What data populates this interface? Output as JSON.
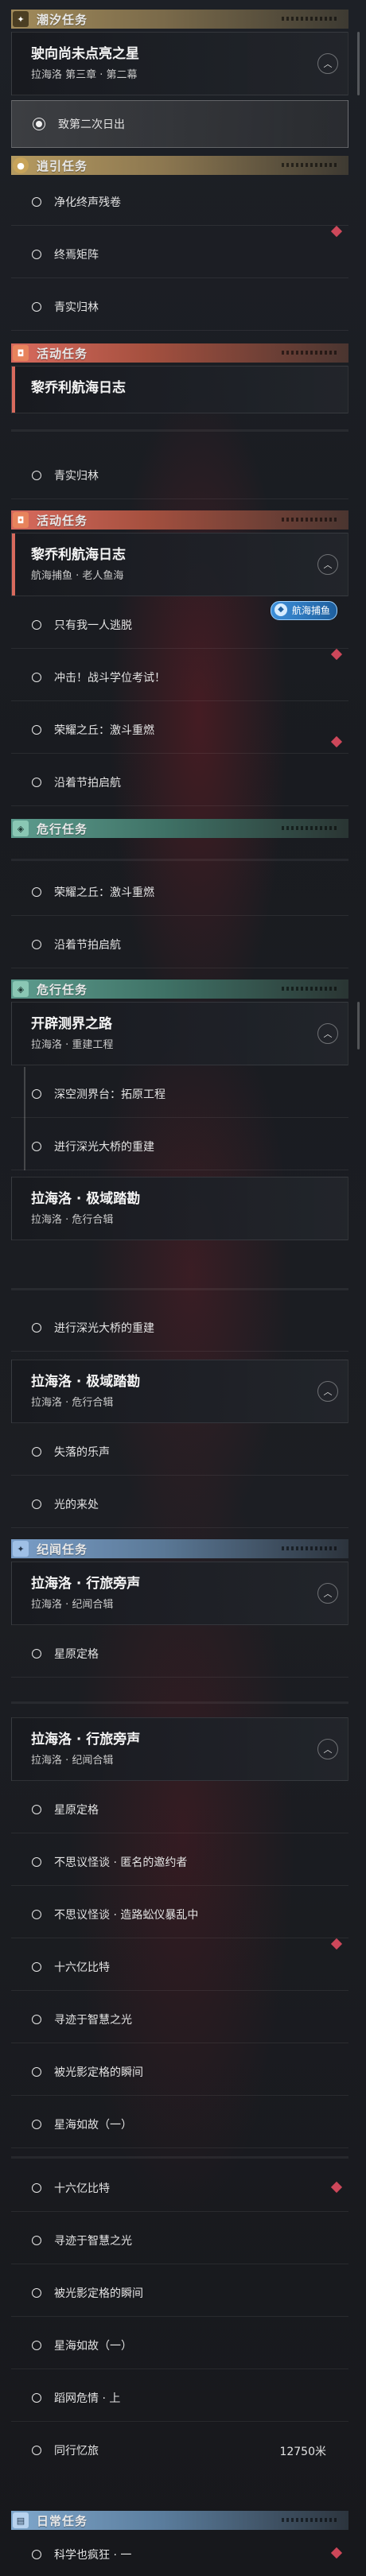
{
  "categories": {
    "tide": "潮汐任务",
    "guide": "逍引任务",
    "event": "活动任务",
    "danger": "危行任务",
    "chronicle": "纪闻任务",
    "daily": "日常任务"
  },
  "quests": {
    "q1": {
      "title": "驶向尚未点亮之星",
      "sub": "拉海洛 第三章 · 第二幕"
    },
    "q2": {
      "title": "黎乔利航海日志"
    },
    "q3": {
      "title": "黎乔利航海日志",
      "sub": "航海捕鱼 · 老人鱼海"
    },
    "q4": {
      "title": "开辟测界之路",
      "sub": "拉海洛 · 重建工程"
    },
    "q5": {
      "title": "拉海洛 · 极域踏勘",
      "sub": "拉海洛 · 危行合辑"
    },
    "q6": {
      "title": "拉海洛 · 极域踏勘",
      "sub": "拉海洛 · 危行合辑"
    },
    "q7": {
      "title": "拉海洛 · 行旅旁声",
      "sub": "拉海洛 · 纪闻合辑"
    },
    "q8": {
      "title": "拉海洛 · 行旅旁声",
      "sub": "拉海洛 · 纪闻合辑"
    }
  },
  "steps": {
    "s1": "致第二次日出",
    "s2": "净化终声残卷",
    "s3": "终焉矩阵",
    "s4": "青实归林",
    "s5": "青实归林",
    "s6": "只有我一人逃脱",
    "s7": "冲击！战斗学位考试！",
    "s8": "荣耀之丘：激斗重燃",
    "s9": "沿着节拍启航",
    "s10": "荣耀之丘：激斗重燃",
    "s11": "沿着节拍启航",
    "s12": "深空测界台：拓原工程",
    "s13": "进行深光大桥的重建",
    "s14": "进行深光大桥的重建",
    "s15": "失落的乐声",
    "s16": "光的来处",
    "s17": "星原定格",
    "s18": "星原定格",
    "s19": "不思议怪谈 · 匿名的邀约者",
    "s20": "不思议怪谈 · 造路蚣仪暴乱中",
    "s21": "十六亿比特",
    "s22": "寻迹于智慧之光",
    "s23": "被光影定格的瞬间",
    "s24": "星海如故（一）",
    "s25": "十六亿比特",
    "s26": "寻迹于智慧之光",
    "s27": "被光影定格的瞬间",
    "s28": "星海如故（一）",
    "s29": "蹈网危情 · 上",
    "s30": "同行忆旅",
    "s31": "科学也疯狂 · 一"
  },
  "distance": "12750米",
  "tag": {
    "label": "航海捕鱼",
    "icon": "fish-icon"
  },
  "colors": {
    "tide": "#a28b5a",
    "event": "#d86a5d",
    "danger": "#5d9c8e",
    "chronicle": "#7a9ec8",
    "marker": "#e14d60"
  }
}
